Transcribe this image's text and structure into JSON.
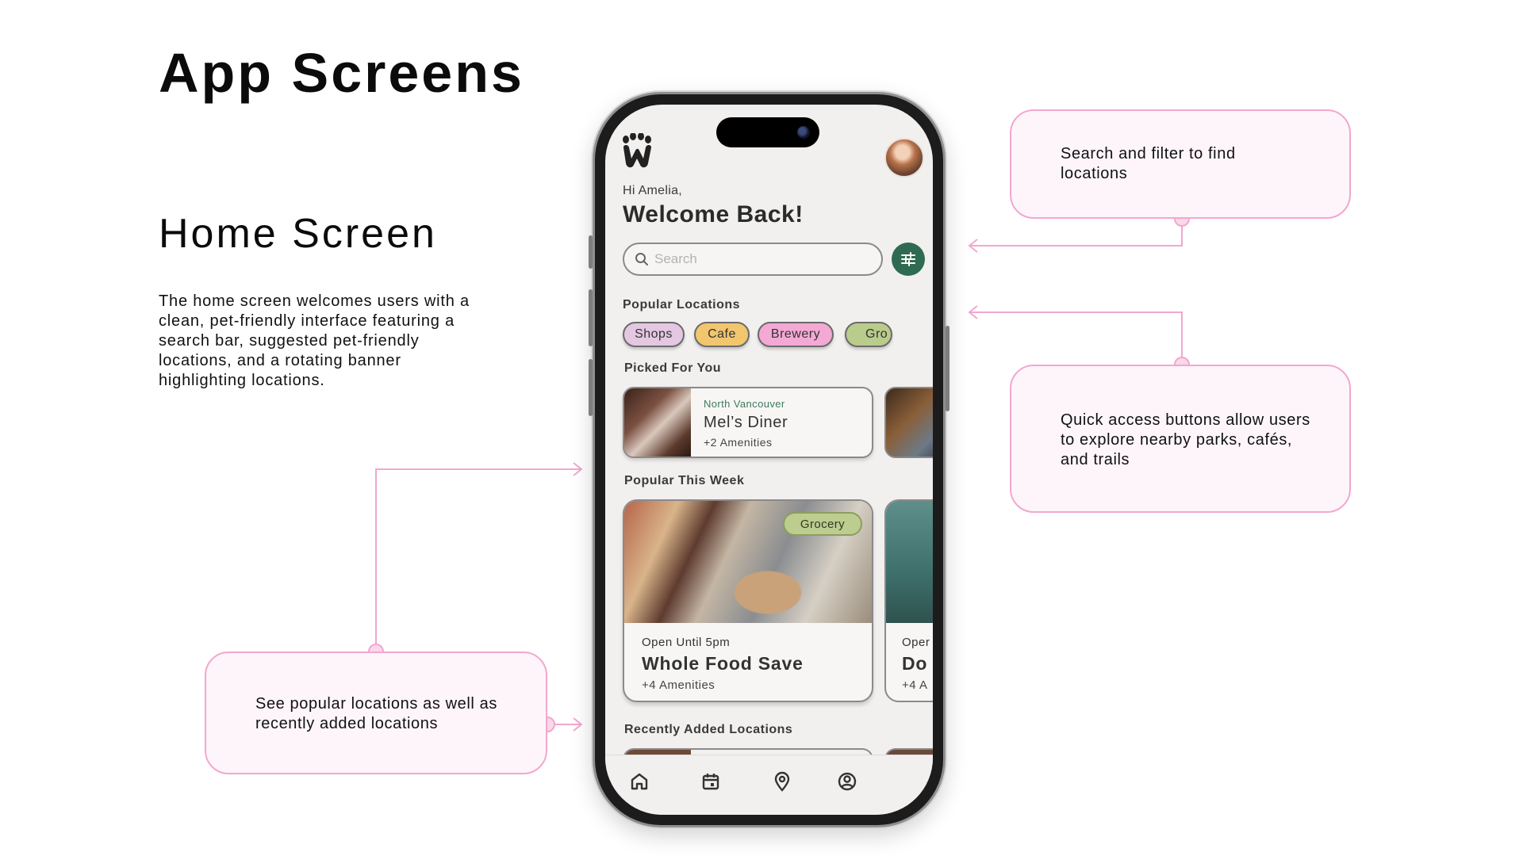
{
  "page": {
    "title": "App Screens",
    "section_title": "Home Screen",
    "section_description": "The home screen welcomes users with a clean, pet-friendly interface featuring a search bar, suggested pet-friendly locations, and a rotating banner highlighting locations."
  },
  "annotations": {
    "search": "Search and filter to find locations",
    "quick_access": "Quick access buttons allow users to explore nearby parks, cafés, and trails",
    "popular": "See popular locations as well as recently added locations"
  },
  "colors": {
    "accent_pink": "#f2a7cf",
    "callout_bg": "#fdf5fa",
    "brand_green": "#2f6b52"
  },
  "app": {
    "greeting": "Hi Amelia,",
    "welcome": "Welcome Back!",
    "search_placeholder": "Search",
    "popular_locations_label": "Popular Locations",
    "categories": [
      {
        "label": "Shops",
        "color": "#e4c7e1"
      },
      {
        "label": "Cafe",
        "color": "#f1c66e"
      },
      {
        "label": "Brewery",
        "color": "#f3a9d4"
      },
      {
        "label": "Gro",
        "color": "#b9cc8c"
      }
    ],
    "picked_for_you_label": "Picked For You",
    "picked": {
      "area": "North Vancouver",
      "name": "Mel’s Diner",
      "amenities": "+2 Amenities"
    },
    "popular_this_week_label": "Popular This Week",
    "popular": {
      "tag": "Grocery",
      "hours": "Open Until 5pm",
      "name": "Whole Food Save",
      "amenities": "+4 Amenities"
    },
    "popular_next": {
      "hours": "Oper",
      "name": "Do",
      "amenities": "+4 A"
    },
    "recently_added_label": "Recently Added Locations",
    "tabs": [
      {
        "icon": "home-icon"
      },
      {
        "icon": "calendar-icon"
      },
      {
        "icon": "map-pin-icon"
      },
      {
        "icon": "profile-icon"
      }
    ]
  }
}
